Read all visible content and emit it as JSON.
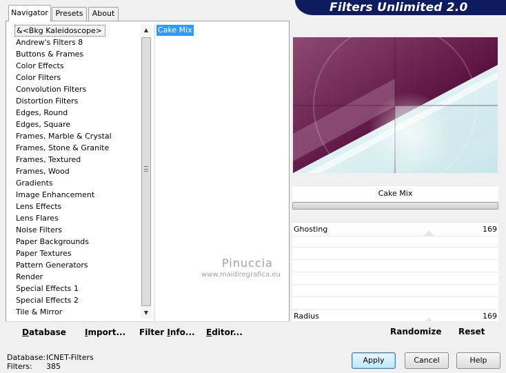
{
  "banner": {
    "title": "Filters Unlimited 2.0"
  },
  "tabs": [
    {
      "label": "Navigator",
      "active": true
    },
    {
      "label": "Presets",
      "active": false
    },
    {
      "label": "About",
      "active": false
    }
  ],
  "categories": [
    "&<Bkg Kaleidoscope>",
    "Andrew's Filters 8",
    "Buttons & Frames",
    "Color Effects",
    "Color Filters",
    "Convolution Filters",
    "Distortion Filters",
    "Edges, Round",
    "Edges, Square",
    "Frames, Marble & Crystal",
    "Frames, Stone & Granite",
    "Frames, Textured",
    "Frames, Wood",
    "Gradients",
    "Image Enhancement",
    "Lens Effects",
    "Lens Flares",
    "Noise Filters",
    "Paper Backgrounds",
    "Paper Textures",
    "Pattern Generators",
    "Render",
    "Special Effects 1",
    "Special Effects 2",
    "Tile & Mirror"
  ],
  "selected_category_index": 0,
  "filters": [
    "Cake Mix"
  ],
  "watermark": {
    "name": "Pinuccia",
    "url": "www.maidiregrafica.eu"
  },
  "navigator_buttons": {
    "database_u": "D",
    "database_rest": "atabase",
    "import_u": "I",
    "import_rest": "mport...",
    "filter_info_pre": "Filter ",
    "filter_info_u": "I",
    "filter_info_rest": "nfo...",
    "editor_u": "E",
    "editor_rest": "ditor..."
  },
  "preview": {
    "filter_name": "Cake Mix",
    "colors": {
      "dark": "#5a1240",
      "mid": "#8e4a72",
      "light": "#d7eef0",
      "white": "#f4fbfb"
    }
  },
  "params": [
    {
      "label": "Ghosting",
      "value": "169"
    },
    {
      "label": "Radius",
      "value": "169"
    }
  ],
  "right_buttons": {
    "randomize": "Randomize",
    "reset": "Reset"
  },
  "footer": {
    "database_label": "Database:",
    "database_value": "ICNET-Filters",
    "filters_label": "Filters:",
    "filters_value": "385",
    "apply": "Apply",
    "cancel": "Cancel",
    "help": "Help"
  }
}
